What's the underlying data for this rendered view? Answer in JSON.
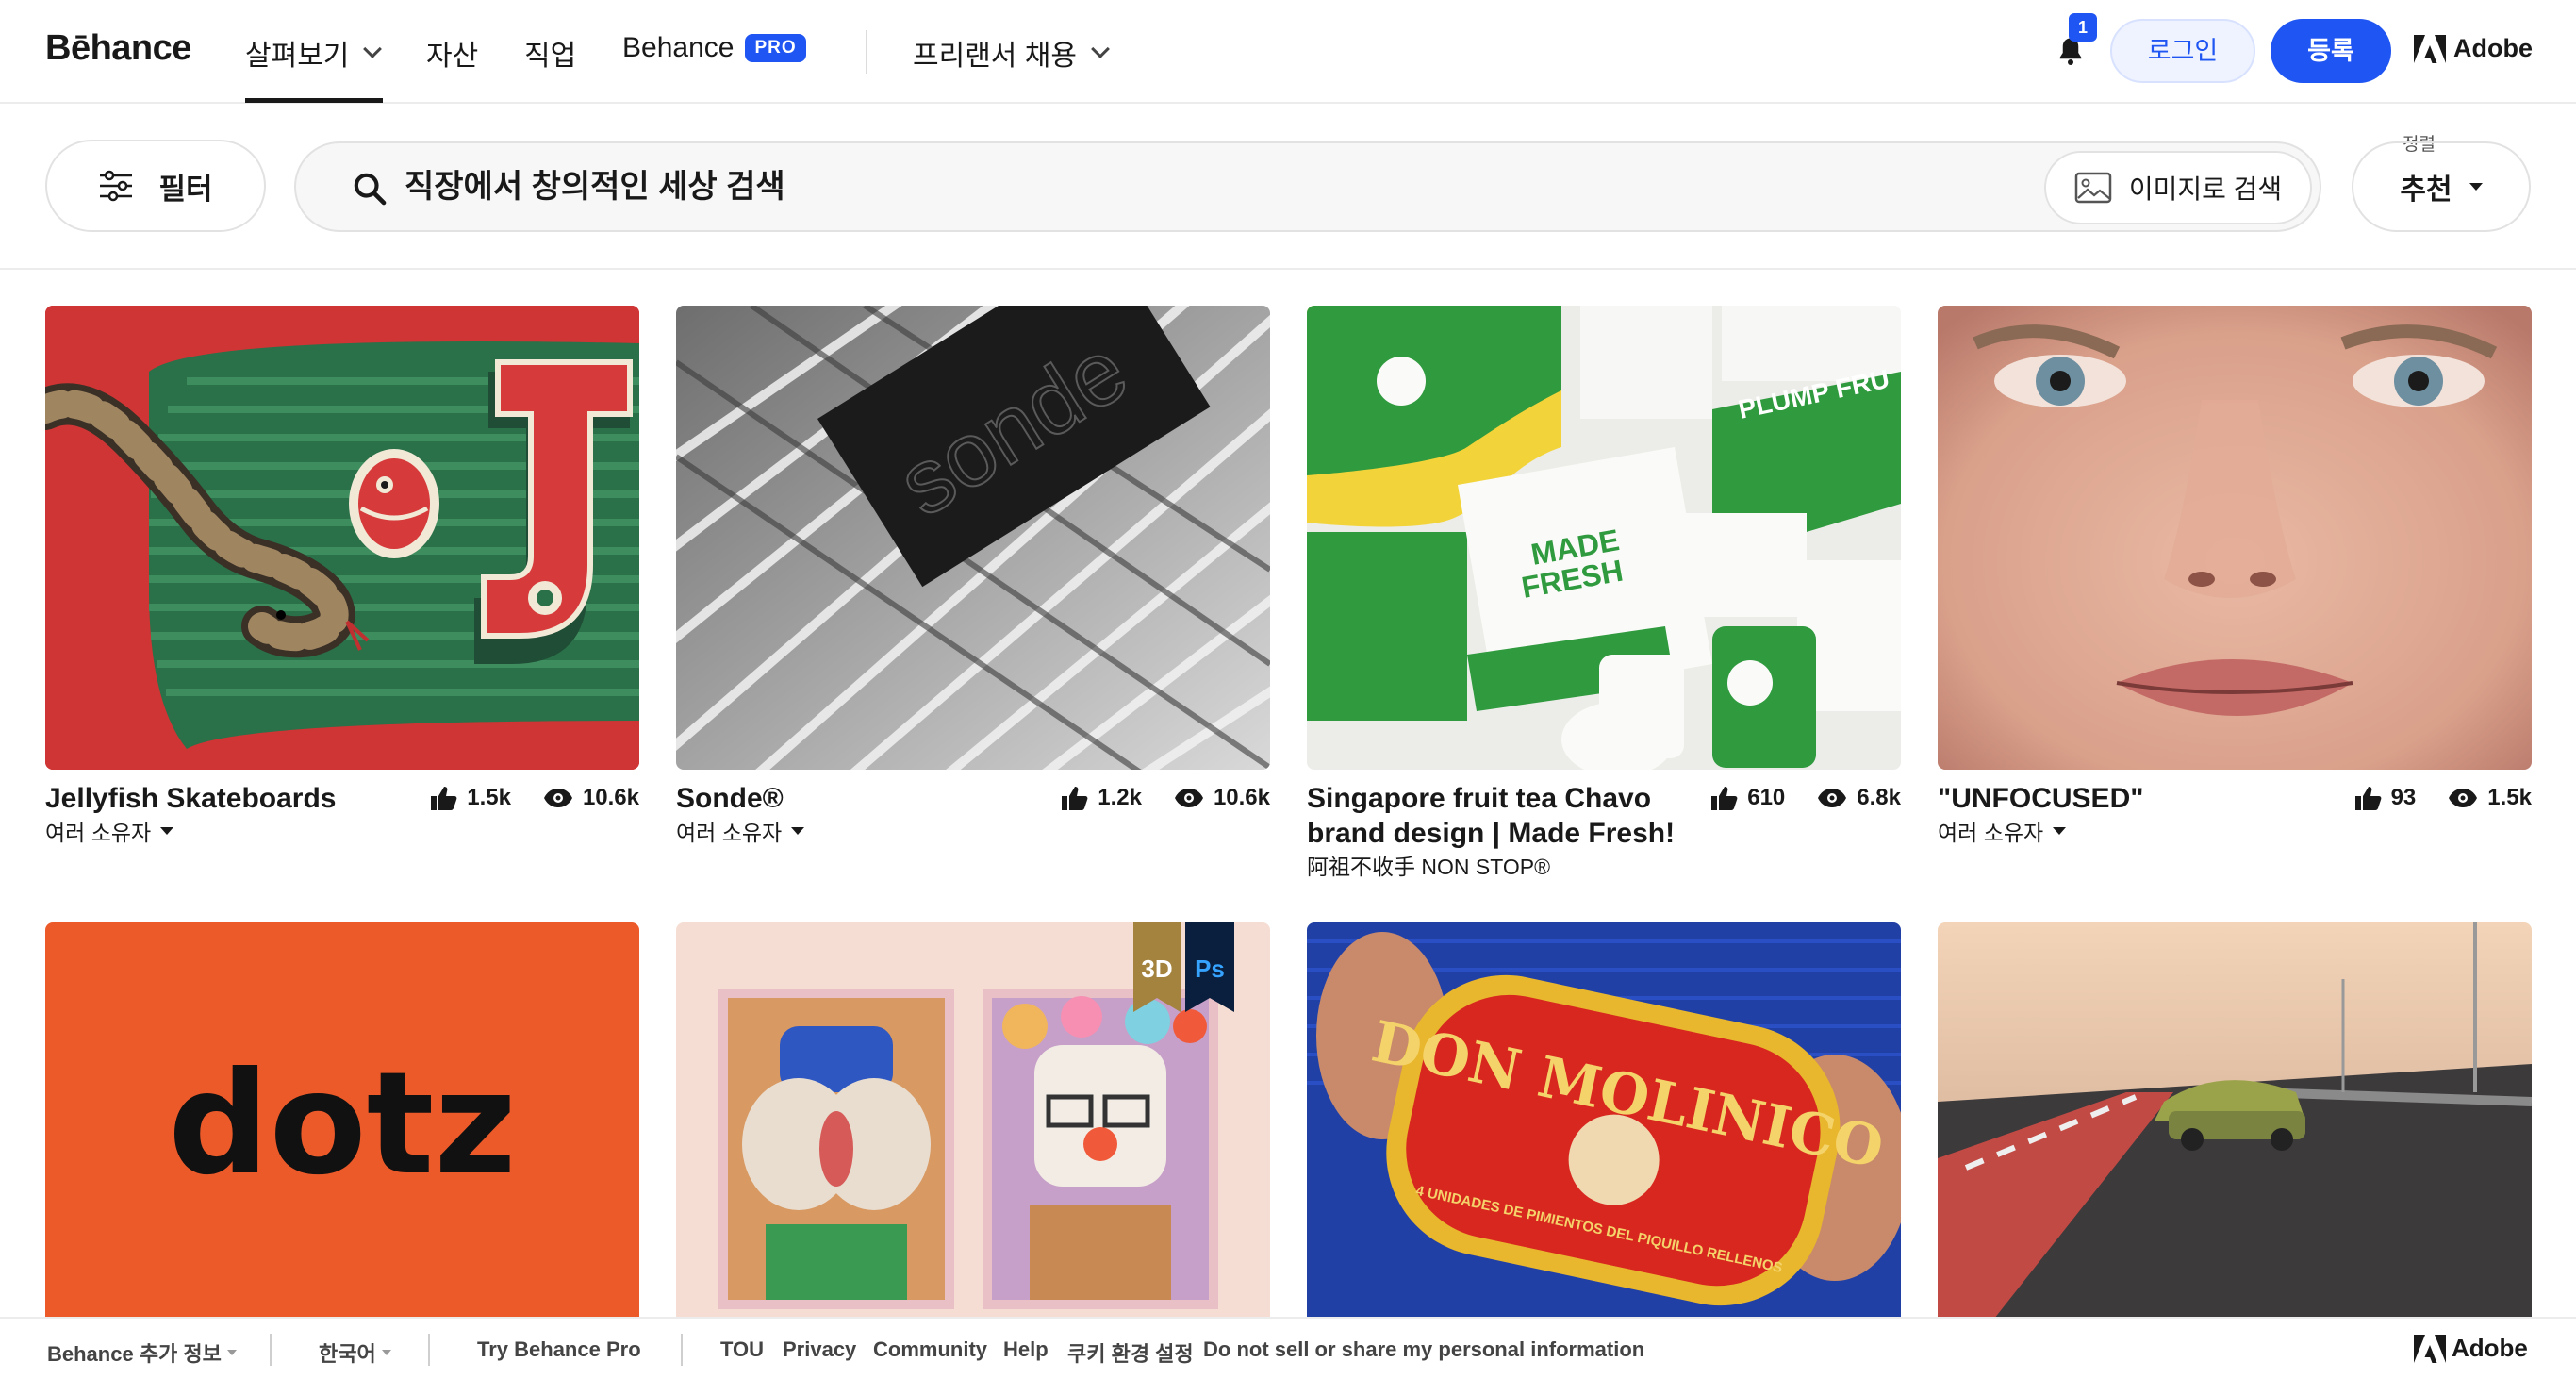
{
  "header": {
    "logo": "Bēhance",
    "nav": [
      {
        "label": "살펴보기",
        "has_dropdown": true,
        "active": true
      },
      {
        "label": "자산"
      },
      {
        "label": "직업"
      },
      {
        "label": "Behance",
        "badge": "PRO"
      },
      {
        "label": "프리랜서 채용",
        "has_dropdown": true
      }
    ],
    "notification_count": "1",
    "login_label": "로그인",
    "signup_label": "등록",
    "adobe_label": "Adobe"
  },
  "search": {
    "filter_label": "필터",
    "placeholder": "직장에서 창의적인 세상 검색",
    "image_search_label": "이미지로 검색",
    "sort_caption": "정렬",
    "sort_value": "추천"
  },
  "projects": [
    {
      "title": "Jellyfish Skateboards",
      "likes": "1.5k",
      "views": "10.6k",
      "owner": "여러 소유자",
      "owner_dropdown": true
    },
    {
      "title": "Sonde®",
      "likes": "1.2k",
      "views": "10.6k",
      "owner": "여러 소유자",
      "owner_dropdown": true
    },
    {
      "title": "Singapore fruit tea Chavo brand design | Made Fresh!",
      "likes": "610",
      "views": "6.8k",
      "owner": "阿祖不收手 NON STOP®",
      "owner_dropdown": false
    },
    {
      "title": "\"UNFOCUSED\"",
      "likes": "93",
      "views": "1.5k",
      "owner": "여러 소유자",
      "owner_dropdown": true
    },
    {
      "thumb_text": "dotz"
    },
    {
      "badges": [
        "3D",
        "Ps"
      ]
    },
    {
      "thumb_text": "DON MOLINICO",
      "thumb_subtext": "4 UNIDADES DE PIMIENTOS DEL PIQUILLO RELLENOS"
    },
    {}
  ],
  "footer": {
    "links": [
      "Behance 추가 정보",
      "한국어",
      "Try Behance Pro",
      "TOU",
      "Privacy",
      "Community",
      "Help",
      "쿠키 환경 설정",
      "Do not sell or share my personal information"
    ],
    "adobe_label": "Adobe"
  },
  "colors": {
    "accent": "#1f55f2",
    "text": "#191919",
    "border": "#e2e2e2"
  }
}
